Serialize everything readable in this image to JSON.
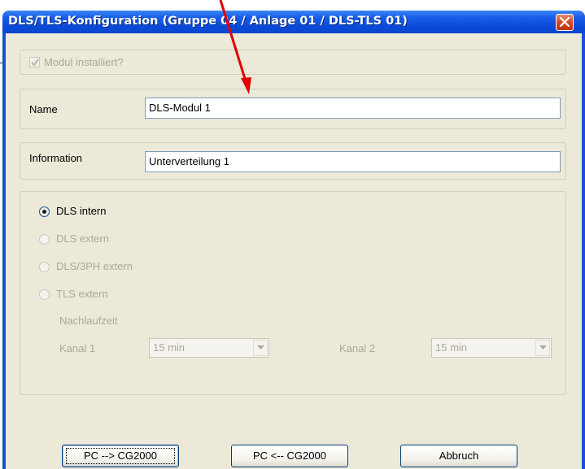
{
  "window": {
    "title": "DLS/TLS-Konfiguration (Gruppe 04 / Anlage 01 / DLS-TLS 01)"
  },
  "module_installed": {
    "label": "Modul installiert?",
    "checked": true,
    "enabled": false
  },
  "name": {
    "label": "Name",
    "value": "DLS-Modul 1"
  },
  "information": {
    "label": "Information",
    "value": "Unterverteilung 1"
  },
  "mode_options": [
    {
      "label": "DLS intern",
      "selected": true,
      "enabled": true
    },
    {
      "label": "DLS extern",
      "selected": false,
      "enabled": false
    },
    {
      "label": "DLS/3PH extern",
      "selected": false,
      "enabled": false
    },
    {
      "label": "TLS extern",
      "selected": false,
      "enabled": false
    }
  ],
  "nachlaufzeit": {
    "label": "Nachlaufzeit",
    "kanal1": {
      "label": "Kanal 1",
      "value": "15 min"
    },
    "kanal2": {
      "label": "Kanal 2",
      "value": "15 min"
    }
  },
  "buttons": {
    "pc_to_cg": "PC --> CG2000",
    "cg_to_pc": "PC <-- CG2000",
    "cancel": "Abbruch"
  },
  "colors": {
    "titlebar": "#0a49d8",
    "dialog_bg": "#ece9d8",
    "annotation_arrow": "#e00000",
    "disabled_text": "#aca899"
  }
}
